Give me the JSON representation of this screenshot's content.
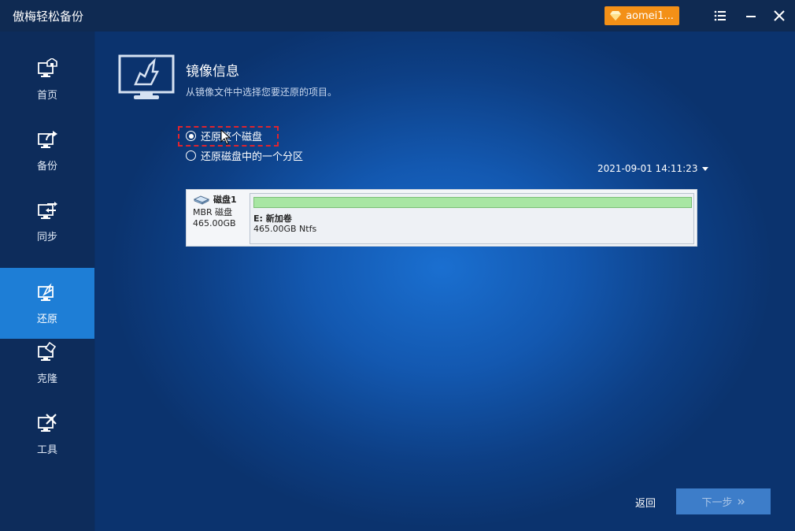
{
  "app": {
    "title": "傲梅轻松备份"
  },
  "titlebar": {
    "account_label": "aomei1..."
  },
  "sidebar": {
    "items": [
      {
        "label": "首页",
        "icon": "home-monitor-icon"
      },
      {
        "label": "备份",
        "icon": "backup-monitor-icon"
      },
      {
        "label": "同步",
        "icon": "sync-monitor-icon"
      },
      {
        "label": "还原",
        "icon": "restore-monitor-icon",
        "active": true
      },
      {
        "label": "克隆",
        "icon": "clone-monitor-icon"
      },
      {
        "label": "工具",
        "icon": "tools-monitor-icon"
      }
    ]
  },
  "main": {
    "heading": "镜像信息",
    "subheading": "从镜像文件中选择您要还原的项目。",
    "options": [
      {
        "label": "还原整个磁盘",
        "checked": true
      },
      {
        "label": "还原磁盘中的一个分区",
        "checked": false
      }
    ],
    "timestamp": "2021-09-01 14:11:23",
    "disk": {
      "name": "磁盘1",
      "type": "MBR 磁盘",
      "size": "465.00GB",
      "partition": {
        "label": "E: 新加卷",
        "size": "465.00GB Ntfs"
      }
    },
    "back_label": "返回",
    "next_label": "下一步"
  },
  "colors": {
    "accent": "#1e7ed6",
    "account": "#f39017",
    "partition": "#a8e6a3"
  }
}
